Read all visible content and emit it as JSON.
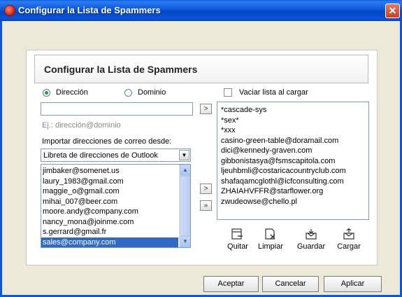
{
  "window": {
    "title": "Configurar la Lista de Spammers",
    "close_glyph": "✕"
  },
  "dialog": {
    "heading": "Configurar la Lista de Spammers"
  },
  "mode": {
    "options": [
      {
        "label": "Dirección",
        "selected": true
      },
      {
        "label": "Dominio",
        "selected": false
      }
    ]
  },
  "entry": {
    "value": "",
    "hint": "Ej.: dirección@dominio"
  },
  "import": {
    "label": "Importar direcciones de correo desde:",
    "source": "Libreta de direcciones de Outlook",
    "contacts": [
      "jimbaker@somenet.us",
      "laury_1983@gmail.com",
      "maggie_o@gmail.com",
      "mihai_007@beer.com",
      "moore.andy@company.com",
      "nancy_mona@joinme.com",
      "s.gerrard@gmail.fr",
      "sales@company.com"
    ],
    "selected_index": 7
  },
  "clear_on_load": {
    "label": "Vaciar lista al cargar",
    "checked": false
  },
  "spammers": [
    "*cascade-sys",
    "*sex*",
    "*xxx",
    "casino-green-table@doramail.com",
    "dici@kennedy-graven.com",
    "gibbonistasya@fsmscapitola.com",
    "ljeuhbmli@costaricacountryclub.com",
    "shafaqamcglothl@icfconsulting.com",
    "ZHAIAHVFFR@starflower.org",
    "zwudeowse@chello.pl"
  ],
  "tools": [
    {
      "label": "Quitar",
      "icon": "remove-icon"
    },
    {
      "label": "Limpiar",
      "icon": "clear-icon"
    },
    {
      "label": "Guardar",
      "icon": "save-icon"
    },
    {
      "label": "Cargar",
      "icon": "load-icon"
    }
  ],
  "buttons": {
    "ok": "Aceptar",
    "cancel": "Cancelar",
    "apply": "Aplicar"
  },
  "colors": {
    "titlebar": "#0d57d8",
    "selection": "#316ac5",
    "radio_dot": "#2a9a2a"
  }
}
